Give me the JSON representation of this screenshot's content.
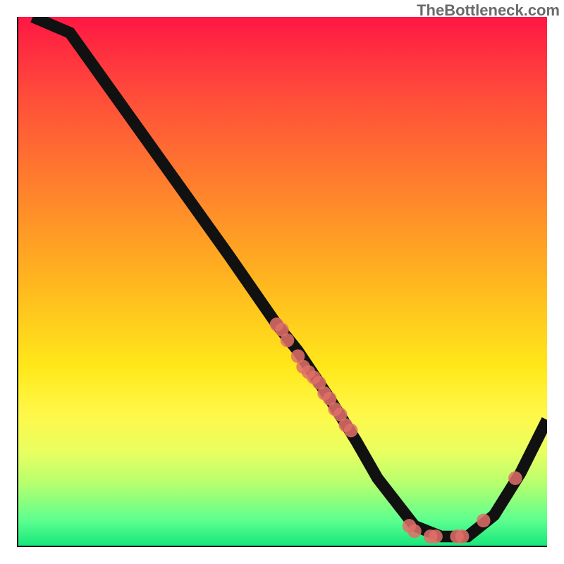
{
  "attribution": "TheBottleneck.com",
  "colors": {
    "gradient_top": "#ff1744",
    "gradient_mid": "#ffe81a",
    "gradient_bottom": "#14e67a",
    "curve": "#111111",
    "dot": "#e17068",
    "axis": "#0a0a0a"
  },
  "chart_data": {
    "type": "line",
    "title": "",
    "xlabel": "",
    "ylabel": "",
    "xlim": [
      0,
      100
    ],
    "ylim": [
      0,
      100
    ],
    "grid": false,
    "legend": false,
    "series": [
      {
        "name": "curve",
        "x": [
          3,
          10,
          20,
          30,
          40,
          49,
          53,
          59,
          64,
          68,
          75,
          80,
          85,
          90,
          95,
          100
        ],
        "y": [
          100,
          97,
          83,
          69,
          55,
          42,
          37,
          28,
          20,
          13,
          4,
          2,
          2,
          6,
          14,
          24
        ]
      }
    ],
    "points": [
      {
        "x": 49,
        "y": 42
      },
      {
        "x": 50,
        "y": 41
      },
      {
        "x": 51,
        "y": 39
      },
      {
        "x": 53,
        "y": 36
      },
      {
        "x": 54,
        "y": 34
      },
      {
        "x": 55,
        "y": 33
      },
      {
        "x": 56,
        "y": 32
      },
      {
        "x": 57,
        "y": 31
      },
      {
        "x": 58,
        "y": 29
      },
      {
        "x": 59,
        "y": 28
      },
      {
        "x": 60,
        "y": 26
      },
      {
        "x": 61,
        "y": 25
      },
      {
        "x": 62,
        "y": 23
      },
      {
        "x": 63,
        "y": 22
      },
      {
        "x": 74,
        "y": 4
      },
      {
        "x": 75,
        "y": 3
      },
      {
        "x": 78,
        "y": 2
      },
      {
        "x": 79,
        "y": 2
      },
      {
        "x": 83,
        "y": 2
      },
      {
        "x": 84,
        "y": 2
      },
      {
        "x": 88,
        "y": 5
      },
      {
        "x": 94,
        "y": 13
      }
    ]
  }
}
